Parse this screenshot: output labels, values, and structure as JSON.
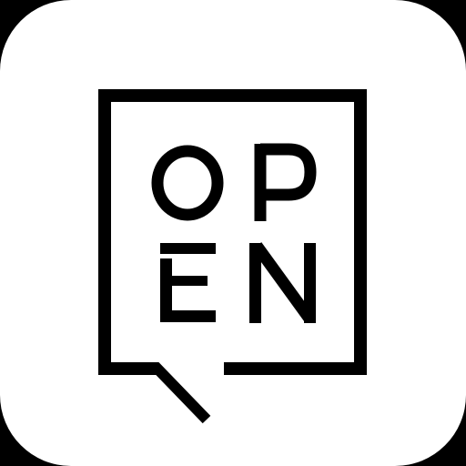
{
  "app_icon": {
    "logo_lettering": "OPEN",
    "icon_name": "speech-bubble-icon",
    "colors": {
      "background": "#ffffff",
      "foreground": "#000000",
      "outer": "#000000"
    }
  }
}
